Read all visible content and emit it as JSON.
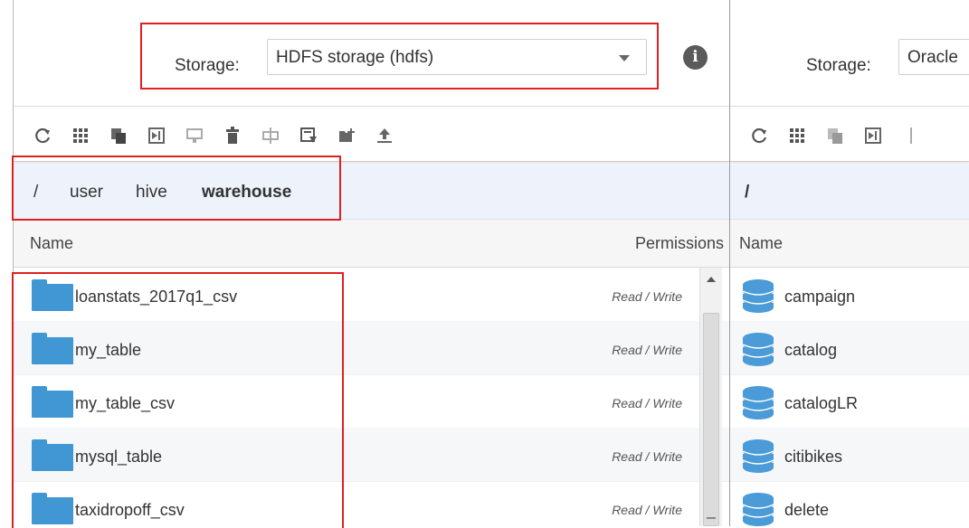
{
  "left": {
    "storage_label": "Storage:",
    "storage_value": "HDFS storage (hdfs)",
    "info_glyph": "i",
    "toolbar_icons": [
      "refresh-icon",
      "grid-icon",
      "copy-icon",
      "move-icon",
      "rename-icon",
      "delete-icon",
      "split-icon",
      "edit-icon",
      "new-folder-icon",
      "upload-icon"
    ],
    "breadcrumb": [
      "/",
      "user",
      "hive",
      "warehouse"
    ],
    "columns": {
      "name": "Name",
      "permissions": "Permissions"
    },
    "rows": [
      {
        "name": "loanstats_2017q1_csv",
        "permission": "Read / Write"
      },
      {
        "name": "my_table",
        "permission": "Read / Write"
      },
      {
        "name": "my_table_csv",
        "permission": "Read / Write"
      },
      {
        "name": "mysql_table",
        "permission": "Read / Write"
      },
      {
        "name": "taxidropoff_csv",
        "permission": "Read / Write"
      }
    ]
  },
  "right": {
    "storage_label": "Storage:",
    "storage_value": "Oracle",
    "toolbar_icons": [
      "refresh-icon",
      "grid-icon",
      "copy-icon",
      "move-icon"
    ],
    "breadcrumb": [
      "/"
    ],
    "columns": {
      "name": "Name"
    },
    "rows": [
      {
        "name": "campaign"
      },
      {
        "name": "catalog"
      },
      {
        "name": "catalogLR"
      },
      {
        "name": "citibikes"
      },
      {
        "name": "delete"
      }
    ]
  },
  "colors": {
    "folder": "#4196d4",
    "database": "#4a9bd8",
    "highlight": "#e02020",
    "breadcrumb_bg": "#eef3fb"
  }
}
